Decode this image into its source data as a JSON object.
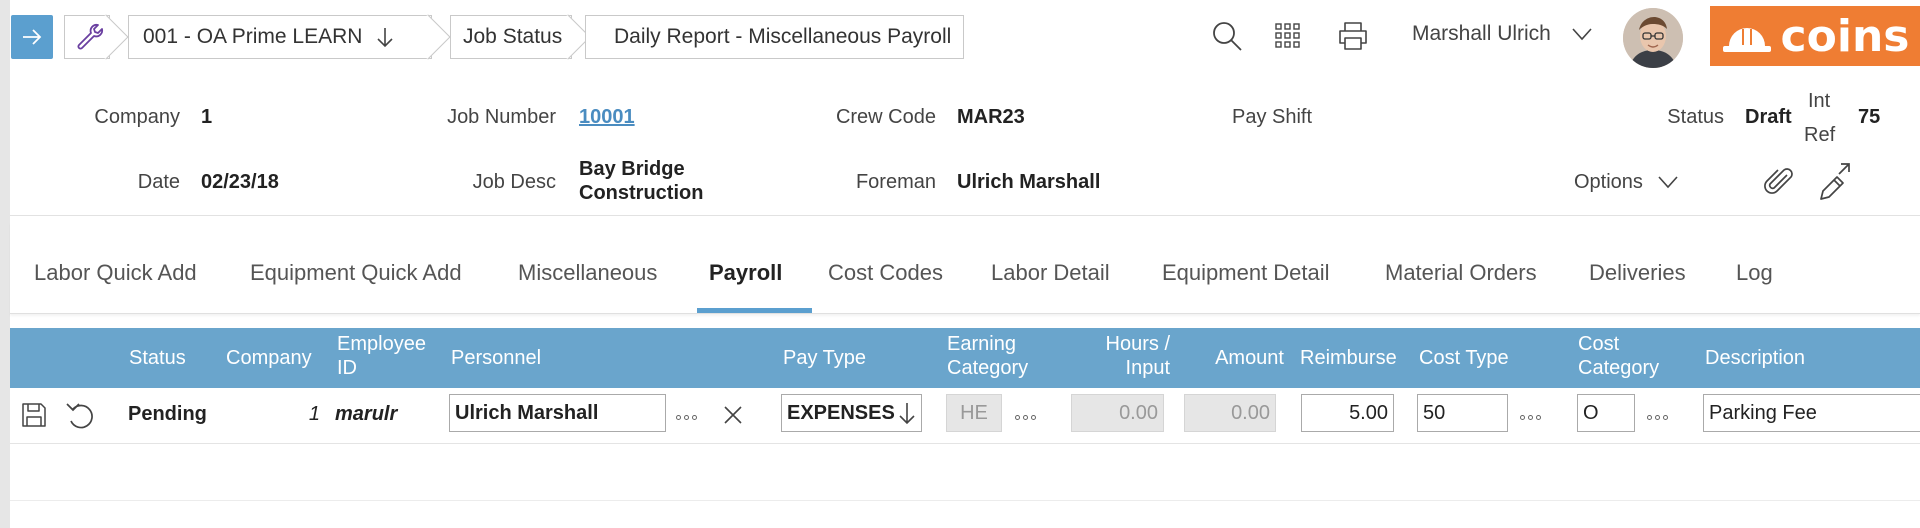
{
  "breadcrumbs": [
    "001 - OA Prime LEARN",
    "Job Status",
    "Daily Report - Miscellaneous Payroll"
  ],
  "user": {
    "name": "Marshall Ulrich"
  },
  "logo": {
    "text": "coins",
    "color": "#ef7d33"
  },
  "accent_color": "#5b9fcf",
  "header": {
    "company_label": "Company",
    "company_value": "1",
    "job_number_label": "Job Number",
    "job_number_value": "10001",
    "crew_code_label": "Crew Code",
    "crew_code_value": "MAR23",
    "pay_shift_label": "Pay Shift",
    "status_label": "Status",
    "status_value": "Draft",
    "int_ref_label_line1": "Int",
    "int_ref_label_line2": "Ref",
    "int_ref_value": "75",
    "date_label": "Date",
    "date_value": "02/23/18",
    "job_desc_label": "Job Desc",
    "job_desc_line1": "Bay Bridge",
    "job_desc_line2": "Construction",
    "foreman_label": "Foreman",
    "foreman_value": "Ulrich Marshall",
    "options_label": "Options"
  },
  "tabs": [
    "Labor Quick Add",
    "Equipment Quick Add",
    "Miscellaneous",
    "Payroll",
    "Cost Codes",
    "Labor Detail",
    "Equipment Detail",
    "Material Orders",
    "Deliveries",
    "Log"
  ],
  "active_tab": "Payroll",
  "grid": {
    "columns": {
      "status": "Status",
      "company": "Company",
      "employee_id_1": "Employee",
      "employee_id_2": "ID",
      "personnel": "Personnel",
      "pay_type": "Pay Type",
      "earning_cat_1": "Earning",
      "earning_cat_2": "Category",
      "hours_1": "Hours /",
      "hours_2": "Input",
      "amount": "Amount",
      "reimburse": "Reimburse",
      "cost_type": "Cost Type",
      "cost_cat_1": "Cost",
      "cost_cat_2": "Category",
      "description": "Description"
    },
    "row": {
      "status": "Pending",
      "company": "1",
      "employee_id": "marulr",
      "personnel": "Ulrich Marshall",
      "pay_type": "EXPENSES",
      "earning_category": "HE",
      "hours": "0.00",
      "amount": "0.00",
      "reimburse": "5.00",
      "cost_type": "50",
      "cost_category": "O",
      "description": "Parking Fee"
    }
  }
}
